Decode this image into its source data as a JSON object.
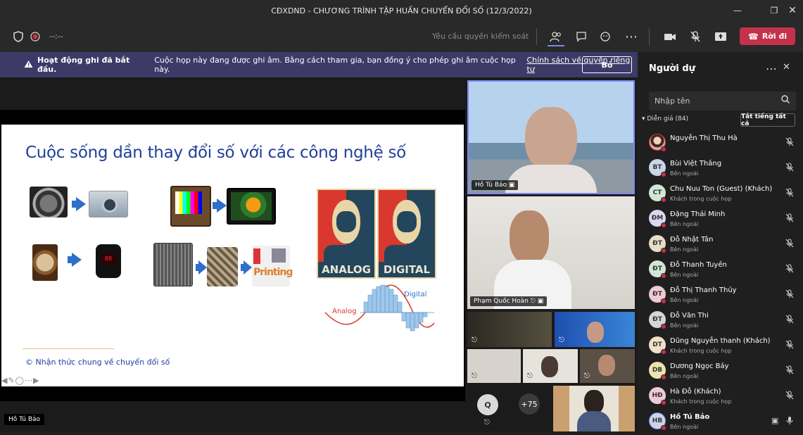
{
  "window": {
    "title": "CĐXDND - CHƯƠNG TRÌNH TẬP HUẤN CHUYỂN ĐỔI SỐ (12/3/2022)"
  },
  "toolbar": {
    "timer": "--:--",
    "request_control": "Yêu cầu quyền kiểm soát",
    "leave_label": "Rời đi"
  },
  "banner": {
    "heading": "Hoạt động ghi đã bắt đầu.",
    "text": "Cuộc họp này đang được ghi âm. Bằng cách tham gia, bạn đồng ý cho phép ghi âm cuộc họp này.",
    "link": "Chính sách về quyền riêng tư",
    "dismiss_label": "Bỏ"
  },
  "slide": {
    "title": "Cuộc sống dần thay đổi số với các công nghệ số",
    "footer": "© Nhận thức chung về chuyển đổi số",
    "analog_label": "ANALOG",
    "digital_label": "DIGITAL",
    "wave_analog": "Analog",
    "wave_digital": "Digital"
  },
  "stage": {
    "presenter_name": "Hồ Tú Bảo",
    "tile1_name": "Hồ Tú Bảo",
    "tile2_name": "Phạm Quốc Hoàn",
    "overflow_count": "+75",
    "guest_initial": "Q"
  },
  "panel": {
    "title": "Người dự",
    "search_placeholder": "Nhập tên",
    "section": "Diễn giả (84)",
    "mute_all": "Tắt tiếng tất cả",
    "participants": [
      {
        "initials": "",
        "name": "Nguyễn Thị Thu Hà",
        "role": "",
        "color": "#e8a6a6"
      },
      {
        "initials": "BT",
        "name": "Bùi Việt Thắng",
        "role": "Bên ngoài",
        "color": "#c9d6e8"
      },
      {
        "initials": "CT",
        "name": "Chu Nuu Ton (Guest) (Khách)",
        "role": "Khách trong cuộc họp",
        "color": "#cfe8d6"
      },
      {
        "initials": "ĐM",
        "name": "Đặng Thái Minh",
        "role": "Bên ngoài",
        "color": "#d9d9ef"
      },
      {
        "initials": "ĐT",
        "name": "Đỗ Nhật Tân",
        "role": "Bên ngoài",
        "color": "#e8dcc9"
      },
      {
        "initials": "ĐT",
        "name": "Đỗ Thanh Tuyền",
        "role": "Bên ngoài",
        "color": "#cfe8d6"
      },
      {
        "initials": "ĐT",
        "name": "Đỗ Thị Thanh Thủy",
        "role": "Bên ngoài",
        "color": "#efc9d3"
      },
      {
        "initials": "ĐT",
        "name": "Đỗ Văn Thi",
        "role": "Bên ngoài",
        "color": "#d6d6d6"
      },
      {
        "initials": "DT",
        "name": "Dũng Nguyễn thanh (Khách)",
        "role": "Khách trong cuộc họp",
        "color": "#efe0c9"
      },
      {
        "initials": "DB",
        "name": "Dương Ngọc Bảy",
        "role": "Bên ngoài",
        "color": "#efe3b0"
      },
      {
        "initials": "HĐ",
        "name": "Hà Đỗ (Khách)",
        "role": "Khách trong cuộc họp",
        "color": "#efc9d3"
      },
      {
        "initials": "HB",
        "name": "Hồ Tú Bảo",
        "role": "Bên ngoài",
        "color": "#c9d6e8"
      }
    ]
  }
}
